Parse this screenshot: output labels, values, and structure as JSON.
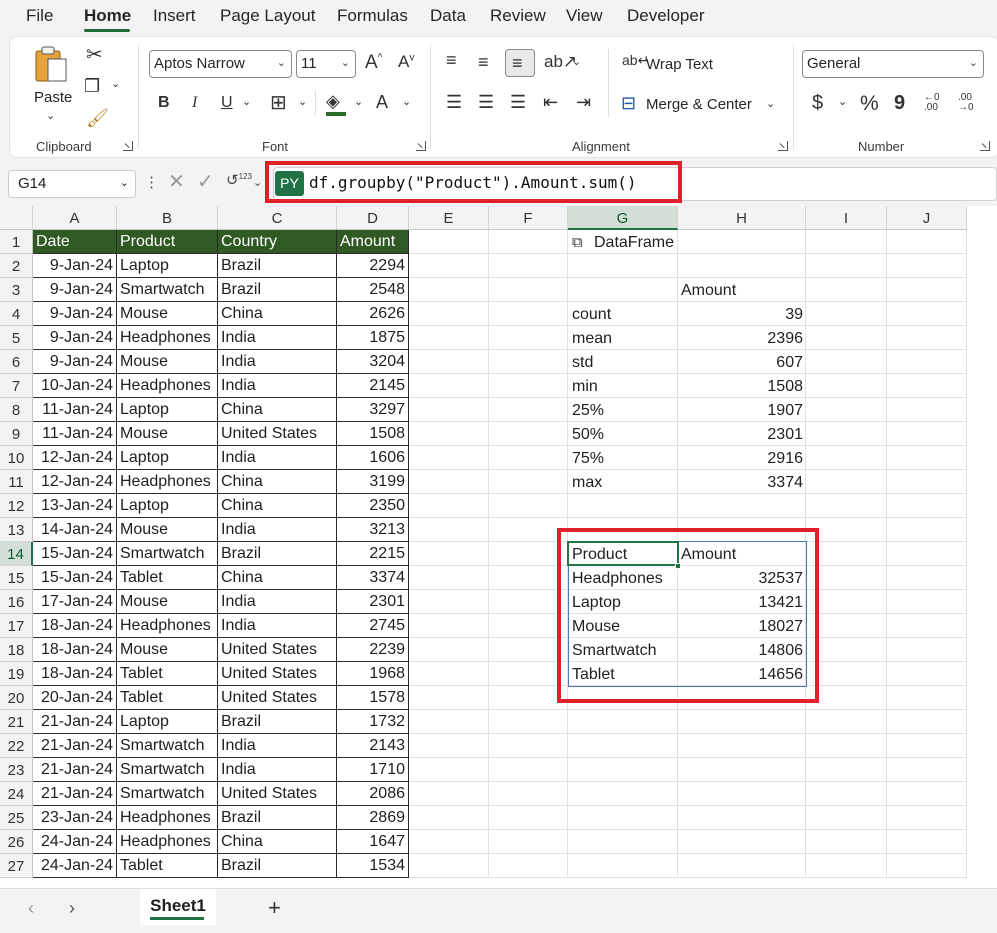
{
  "menu": {
    "tabs": [
      "File",
      "Home",
      "Insert",
      "Page Layout",
      "Formulas",
      "Data",
      "Review",
      "View",
      "Developer"
    ],
    "active": "Home"
  },
  "ribbon": {
    "clipboard": {
      "paste_label": "Paste",
      "group_label": "Clipboard"
    },
    "font": {
      "font_name": "Aptos Narrow",
      "font_size": "11",
      "bold": "B",
      "italic": "I",
      "underline": "U",
      "group_label": "Font"
    },
    "alignment": {
      "wrap_text": "Wrap Text",
      "merge_center": "Merge & Center",
      "group_label": "Alignment"
    },
    "number": {
      "format": "General",
      "currency": "$",
      "percent": "%",
      "comma": "9",
      "inc_decimal": "←0 .00",
      "dec_decimal": ".00 →0",
      "group_label": "Number"
    }
  },
  "formula_bar": {
    "name_box": "G14",
    "py_badge": "PY",
    "formula": "df.groupby(\"Product\").Amount.sum()",
    "highlight_color": "#e0202a"
  },
  "sheet": {
    "columns": [
      "A",
      "B",
      "C",
      "D",
      "E",
      "F",
      "G",
      "H",
      "I",
      "J"
    ],
    "selected_column": "G",
    "selected_row": "14",
    "rows": [
      "1",
      "2",
      "3",
      "4",
      "5",
      "6",
      "7",
      "8",
      "9",
      "10",
      "11",
      "12",
      "13",
      "14",
      "15",
      "16",
      "17",
      "18",
      "19",
      "20",
      "21",
      "22",
      "23",
      "24",
      "25",
      "26",
      "27"
    ],
    "table_header": [
      "Date",
      "Product",
      "Country",
      "Amount"
    ],
    "table_header_color": "#2f5a24",
    "table_rows": [
      [
        "9-Jan-24",
        "Laptop",
        "Brazil",
        "2294"
      ],
      [
        "9-Jan-24",
        "Smartwatch",
        "Brazil",
        "2548"
      ],
      [
        "9-Jan-24",
        "Mouse",
        "China",
        "2626"
      ],
      [
        "9-Jan-24",
        "Headphones",
        "India",
        "1875"
      ],
      [
        "9-Jan-24",
        "Mouse",
        "India",
        "3204"
      ],
      [
        "10-Jan-24",
        "Headphones",
        "India",
        "2145"
      ],
      [
        "11-Jan-24",
        "Laptop",
        "China",
        "3297"
      ],
      [
        "11-Jan-24",
        "Mouse",
        "United States",
        "1508"
      ],
      [
        "12-Jan-24",
        "Laptop",
        "India",
        "1606"
      ],
      [
        "12-Jan-24",
        "Headphones",
        "China",
        "3199"
      ],
      [
        "13-Jan-24",
        "Laptop",
        "China",
        "2350"
      ],
      [
        "14-Jan-24",
        "Mouse",
        "India",
        "3213"
      ],
      [
        "15-Jan-24",
        "Smartwatch",
        "Brazil",
        "2215"
      ],
      [
        "15-Jan-24",
        "Tablet",
        "China",
        "3374"
      ],
      [
        "17-Jan-24",
        "Mouse",
        "India",
        "2301"
      ],
      [
        "18-Jan-24",
        "Headphones",
        "India",
        "2745"
      ],
      [
        "18-Jan-24",
        "Mouse",
        "United States",
        "2239"
      ],
      [
        "18-Jan-24",
        "Tablet",
        "United States",
        "1968"
      ],
      [
        "20-Jan-24",
        "Tablet",
        "United States",
        "1578"
      ],
      [
        "21-Jan-24",
        "Laptop",
        "Brazil",
        "1732"
      ],
      [
        "21-Jan-24",
        "Smartwatch",
        "India",
        "2143"
      ],
      [
        "21-Jan-24",
        "Smartwatch",
        "India",
        "1710"
      ],
      [
        "21-Jan-24",
        "Smartwatch",
        "United States",
        "2086"
      ],
      [
        "23-Jan-24",
        "Headphones",
        "Brazil",
        "2869"
      ],
      [
        "24-Jan-24",
        "Headphones",
        "China",
        "1647"
      ],
      [
        "24-Jan-24",
        "Tablet",
        "Brazil",
        "1534"
      ]
    ],
    "dataframe_label": "DataFrame",
    "describe": {
      "header": "Amount",
      "rows": [
        [
          "count",
          "39"
        ],
        [
          "mean",
          "2396"
        ],
        [
          "std",
          "607"
        ],
        [
          "min",
          "1508"
        ],
        [
          "25%",
          "1907"
        ],
        [
          "50%",
          "2301"
        ],
        [
          "75%",
          "2916"
        ],
        [
          "max",
          "3374"
        ]
      ]
    },
    "groupby_result": {
      "header": [
        "Product",
        "Amount"
      ],
      "rows": [
        [
          "Headphones",
          "32537"
        ],
        [
          "Laptop",
          "13421"
        ],
        [
          "Mouse",
          "18027"
        ],
        [
          "Smartwatch",
          "14806"
        ],
        [
          "Tablet",
          "14656"
        ]
      ]
    }
  },
  "sheet_tabs": {
    "active": "Sheet1",
    "add": "+"
  }
}
